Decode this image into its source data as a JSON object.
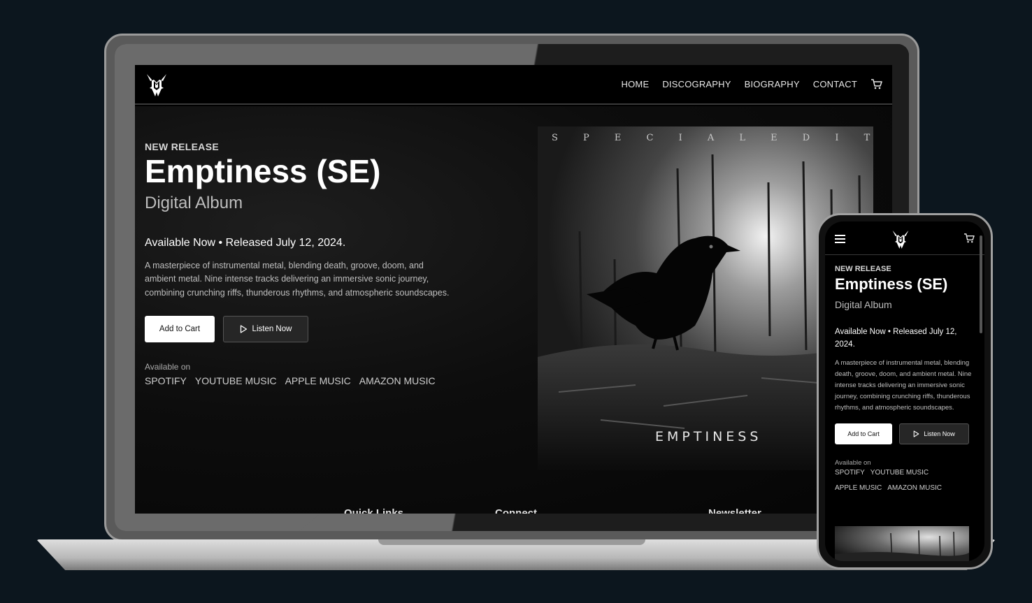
{
  "nav": {
    "items": [
      "HOME",
      "DISCOGRAPHY",
      "BIOGRAPHY",
      "CONTACT"
    ]
  },
  "hero": {
    "eyebrow": "NEW RELEASE",
    "title": "Emptiness (SE)",
    "subtitle": "Digital Album",
    "availability": "Available Now • Released July 12, 2024.",
    "description": "A masterpiece of instrumental metal, blending death, groove, doom, and ambient metal. Nine intense tracks delivering an immersive sonic journey, combining crunching riffs, thunderous rhythms, and atmospheric soundscapes.",
    "add_to_cart": "Add to Cart",
    "listen_now": "Listen Now",
    "available_on": "Available on",
    "platforms": [
      "SPOTIFY",
      "YOUTUBE MUSIC",
      "APPLE MUSIC",
      "AMAZON MUSIC"
    ]
  },
  "album_art": {
    "top_text": "S P E C I A L   E D I T I O N",
    "bottom_text": "EMPTINESS"
  },
  "footer_peek": {
    "quick_links": "Quick Links",
    "connect": "Connect",
    "newsletter": "Newsletter"
  },
  "colors": {
    "page_bg": "#0c161e",
    "screen_bg": "#000000",
    "primary_button": "#ffffff",
    "secondary_button": "#262626"
  }
}
